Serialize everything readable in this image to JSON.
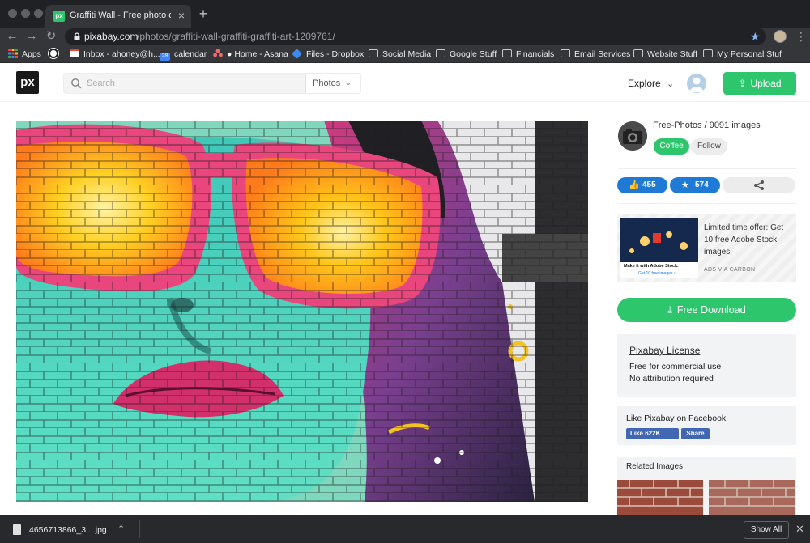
{
  "browser": {
    "tab_title": "Graffiti Wall - Free photo on Pixabay",
    "tab_favicon_text": "px",
    "url_host": "pixabay.com",
    "url_path": "/photos/graffiti-wall-graffiti-graffiti-art-1209761/",
    "bookmarks": [
      {
        "label": "Apps",
        "icon": "apps-grid-icon"
      },
      {
        "label": "",
        "icon": "globe-icon"
      },
      {
        "label": "Inbox - ahoney@h...",
        "icon": "gmail-icon"
      },
      {
        "label": "calendar",
        "icon": "calendar-icon"
      },
      {
        "label": "Home - Asana",
        "icon": "asana-icon"
      },
      {
        "label": "Files - Dropbox",
        "icon": "dropbox-icon"
      },
      {
        "label": "Social Media",
        "icon": "folder-icon"
      },
      {
        "label": "Google Stuff",
        "icon": "folder-icon"
      },
      {
        "label": "Financials",
        "icon": "folder-icon"
      },
      {
        "label": "Email Services",
        "icon": "folder-icon"
      },
      {
        "label": "Website Stuff",
        "icon": "folder-icon"
      },
      {
        "label": "My Personal Stuf",
        "icon": "folder-icon"
      }
    ],
    "calendar_day": "28"
  },
  "header": {
    "logo_text": "px",
    "search_placeholder": "Search",
    "search_type": "Photos",
    "explore_label": "Explore",
    "upload_label": "Upload"
  },
  "sidebar": {
    "author_text": "Free-Photos / 9091 images",
    "coffee_label": "Coffee",
    "follow_label": "Follow",
    "likes": "455",
    "favorites": "574",
    "ad": {
      "text": "Limited time offer: Get 10 free Adobe Stock images.",
      "via": "ADS VIA CARBON",
      "image_caption": "Make it with Adobe Stock.",
      "image_subcaption": "Get 10 free images ›"
    },
    "download_label": "Free Download",
    "license": {
      "title": "Pixabay License",
      "line1": "Free for commercial use",
      "line2": "No attribution required"
    },
    "facebook": {
      "title": "Like Pixabay on Facebook",
      "like_label": "Like 622K",
      "share_label": "Share"
    },
    "related_title": "Related Images"
  },
  "download_bar": {
    "file_name": "4656713866_3....jpg",
    "show_all_label": "Show All"
  },
  "colors": {
    "brand_green": "#2ec66d",
    "like_blue": "#1f7ad6",
    "facebook_blue": "#4267b2",
    "chrome_dark": "#202124"
  }
}
